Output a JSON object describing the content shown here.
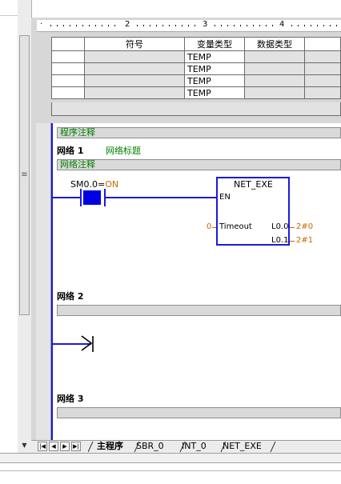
{
  "ruler": {
    "numbers": [
      "2",
      "3",
      "4"
    ]
  },
  "var_table": {
    "headers": [
      "",
      "符号",
      "变量类型",
      "数据类型"
    ],
    "rows": [
      {
        "type": "TEMP"
      },
      {
        "type": "TEMP"
      },
      {
        "type": "TEMP"
      },
      {
        "type": "TEMP"
      }
    ]
  },
  "program": {
    "program_comment": "程序注释",
    "network1": {
      "label": "网络 1",
      "title": "网络标题",
      "comment": "网络注释",
      "contact": {
        "name": "SM0.0",
        "sep": "=",
        "state": "ON"
      },
      "function_block": {
        "name": "NET_EXE",
        "en": "EN",
        "input_name": "Timeout",
        "input_value": "0",
        "outputs": [
          {
            "name": "L0.0",
            "value": "2#0"
          },
          {
            "name": "L0.1",
            "value": "2#1"
          }
        ]
      }
    },
    "network2": {
      "label": "网络 2"
    },
    "network3": {
      "label": "网络 3"
    }
  },
  "tabs": {
    "nav": [
      "first-icon",
      "prev-icon",
      "next-icon",
      "last-icon"
    ],
    "items": [
      "主程序",
      "SBR_0",
      "INT_0",
      "NET_EXE"
    ],
    "active": "主程序"
  },
  "colors": {
    "wire": "#1a1adc",
    "comment": "#008000",
    "value": "#cc6600"
  }
}
